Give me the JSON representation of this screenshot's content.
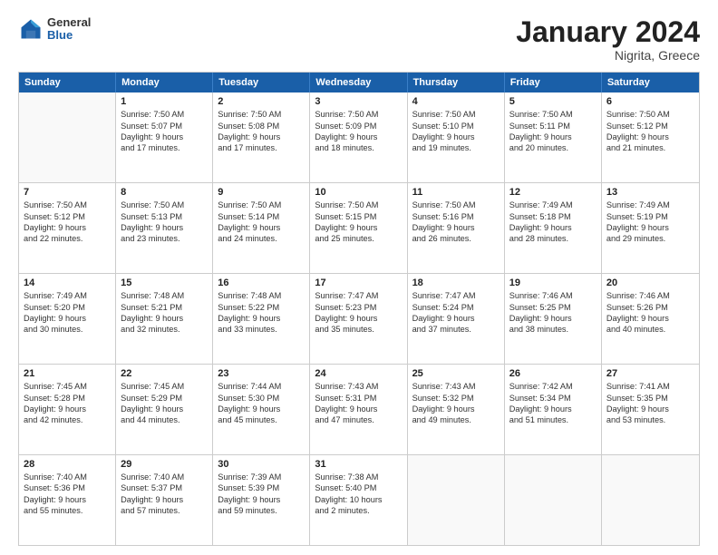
{
  "header": {
    "logo": {
      "general": "General",
      "blue": "Blue"
    },
    "title": "January 2024",
    "location": "Nigrita, Greece"
  },
  "days_of_week": [
    "Sunday",
    "Monday",
    "Tuesday",
    "Wednesday",
    "Thursday",
    "Friday",
    "Saturday"
  ],
  "weeks": [
    [
      {
        "day": "",
        "lines": []
      },
      {
        "day": "1",
        "lines": [
          "Sunrise: 7:50 AM",
          "Sunset: 5:07 PM",
          "Daylight: 9 hours",
          "and 17 minutes."
        ]
      },
      {
        "day": "2",
        "lines": [
          "Sunrise: 7:50 AM",
          "Sunset: 5:08 PM",
          "Daylight: 9 hours",
          "and 17 minutes."
        ]
      },
      {
        "day": "3",
        "lines": [
          "Sunrise: 7:50 AM",
          "Sunset: 5:09 PM",
          "Daylight: 9 hours",
          "and 18 minutes."
        ]
      },
      {
        "day": "4",
        "lines": [
          "Sunrise: 7:50 AM",
          "Sunset: 5:10 PM",
          "Daylight: 9 hours",
          "and 19 minutes."
        ]
      },
      {
        "day": "5",
        "lines": [
          "Sunrise: 7:50 AM",
          "Sunset: 5:11 PM",
          "Daylight: 9 hours",
          "and 20 minutes."
        ]
      },
      {
        "day": "6",
        "lines": [
          "Sunrise: 7:50 AM",
          "Sunset: 5:12 PM",
          "Daylight: 9 hours",
          "and 21 minutes."
        ]
      }
    ],
    [
      {
        "day": "7",
        "lines": [
          "Sunrise: 7:50 AM",
          "Sunset: 5:12 PM",
          "Daylight: 9 hours",
          "and 22 minutes."
        ]
      },
      {
        "day": "8",
        "lines": [
          "Sunrise: 7:50 AM",
          "Sunset: 5:13 PM",
          "Daylight: 9 hours",
          "and 23 minutes."
        ]
      },
      {
        "day": "9",
        "lines": [
          "Sunrise: 7:50 AM",
          "Sunset: 5:14 PM",
          "Daylight: 9 hours",
          "and 24 minutes."
        ]
      },
      {
        "day": "10",
        "lines": [
          "Sunrise: 7:50 AM",
          "Sunset: 5:15 PM",
          "Daylight: 9 hours",
          "and 25 minutes."
        ]
      },
      {
        "day": "11",
        "lines": [
          "Sunrise: 7:50 AM",
          "Sunset: 5:16 PM",
          "Daylight: 9 hours",
          "and 26 minutes."
        ]
      },
      {
        "day": "12",
        "lines": [
          "Sunrise: 7:49 AM",
          "Sunset: 5:18 PM",
          "Daylight: 9 hours",
          "and 28 minutes."
        ]
      },
      {
        "day": "13",
        "lines": [
          "Sunrise: 7:49 AM",
          "Sunset: 5:19 PM",
          "Daylight: 9 hours",
          "and 29 minutes."
        ]
      }
    ],
    [
      {
        "day": "14",
        "lines": [
          "Sunrise: 7:49 AM",
          "Sunset: 5:20 PM",
          "Daylight: 9 hours",
          "and 30 minutes."
        ]
      },
      {
        "day": "15",
        "lines": [
          "Sunrise: 7:48 AM",
          "Sunset: 5:21 PM",
          "Daylight: 9 hours",
          "and 32 minutes."
        ]
      },
      {
        "day": "16",
        "lines": [
          "Sunrise: 7:48 AM",
          "Sunset: 5:22 PM",
          "Daylight: 9 hours",
          "and 33 minutes."
        ]
      },
      {
        "day": "17",
        "lines": [
          "Sunrise: 7:47 AM",
          "Sunset: 5:23 PM",
          "Daylight: 9 hours",
          "and 35 minutes."
        ]
      },
      {
        "day": "18",
        "lines": [
          "Sunrise: 7:47 AM",
          "Sunset: 5:24 PM",
          "Daylight: 9 hours",
          "and 37 minutes."
        ]
      },
      {
        "day": "19",
        "lines": [
          "Sunrise: 7:46 AM",
          "Sunset: 5:25 PM",
          "Daylight: 9 hours",
          "and 38 minutes."
        ]
      },
      {
        "day": "20",
        "lines": [
          "Sunrise: 7:46 AM",
          "Sunset: 5:26 PM",
          "Daylight: 9 hours",
          "and 40 minutes."
        ]
      }
    ],
    [
      {
        "day": "21",
        "lines": [
          "Sunrise: 7:45 AM",
          "Sunset: 5:28 PM",
          "Daylight: 9 hours",
          "and 42 minutes."
        ]
      },
      {
        "day": "22",
        "lines": [
          "Sunrise: 7:45 AM",
          "Sunset: 5:29 PM",
          "Daylight: 9 hours",
          "and 44 minutes."
        ]
      },
      {
        "day": "23",
        "lines": [
          "Sunrise: 7:44 AM",
          "Sunset: 5:30 PM",
          "Daylight: 9 hours",
          "and 45 minutes."
        ]
      },
      {
        "day": "24",
        "lines": [
          "Sunrise: 7:43 AM",
          "Sunset: 5:31 PM",
          "Daylight: 9 hours",
          "and 47 minutes."
        ]
      },
      {
        "day": "25",
        "lines": [
          "Sunrise: 7:43 AM",
          "Sunset: 5:32 PM",
          "Daylight: 9 hours",
          "and 49 minutes."
        ]
      },
      {
        "day": "26",
        "lines": [
          "Sunrise: 7:42 AM",
          "Sunset: 5:34 PM",
          "Daylight: 9 hours",
          "and 51 minutes."
        ]
      },
      {
        "day": "27",
        "lines": [
          "Sunrise: 7:41 AM",
          "Sunset: 5:35 PM",
          "Daylight: 9 hours",
          "and 53 minutes."
        ]
      }
    ],
    [
      {
        "day": "28",
        "lines": [
          "Sunrise: 7:40 AM",
          "Sunset: 5:36 PM",
          "Daylight: 9 hours",
          "and 55 minutes."
        ]
      },
      {
        "day": "29",
        "lines": [
          "Sunrise: 7:40 AM",
          "Sunset: 5:37 PM",
          "Daylight: 9 hours",
          "and 57 minutes."
        ]
      },
      {
        "day": "30",
        "lines": [
          "Sunrise: 7:39 AM",
          "Sunset: 5:39 PM",
          "Daylight: 9 hours",
          "and 59 minutes."
        ]
      },
      {
        "day": "31",
        "lines": [
          "Sunrise: 7:38 AM",
          "Sunset: 5:40 PM",
          "Daylight: 10 hours",
          "and 2 minutes."
        ]
      },
      {
        "day": "",
        "lines": []
      },
      {
        "day": "",
        "lines": []
      },
      {
        "day": "",
        "lines": []
      }
    ]
  ]
}
